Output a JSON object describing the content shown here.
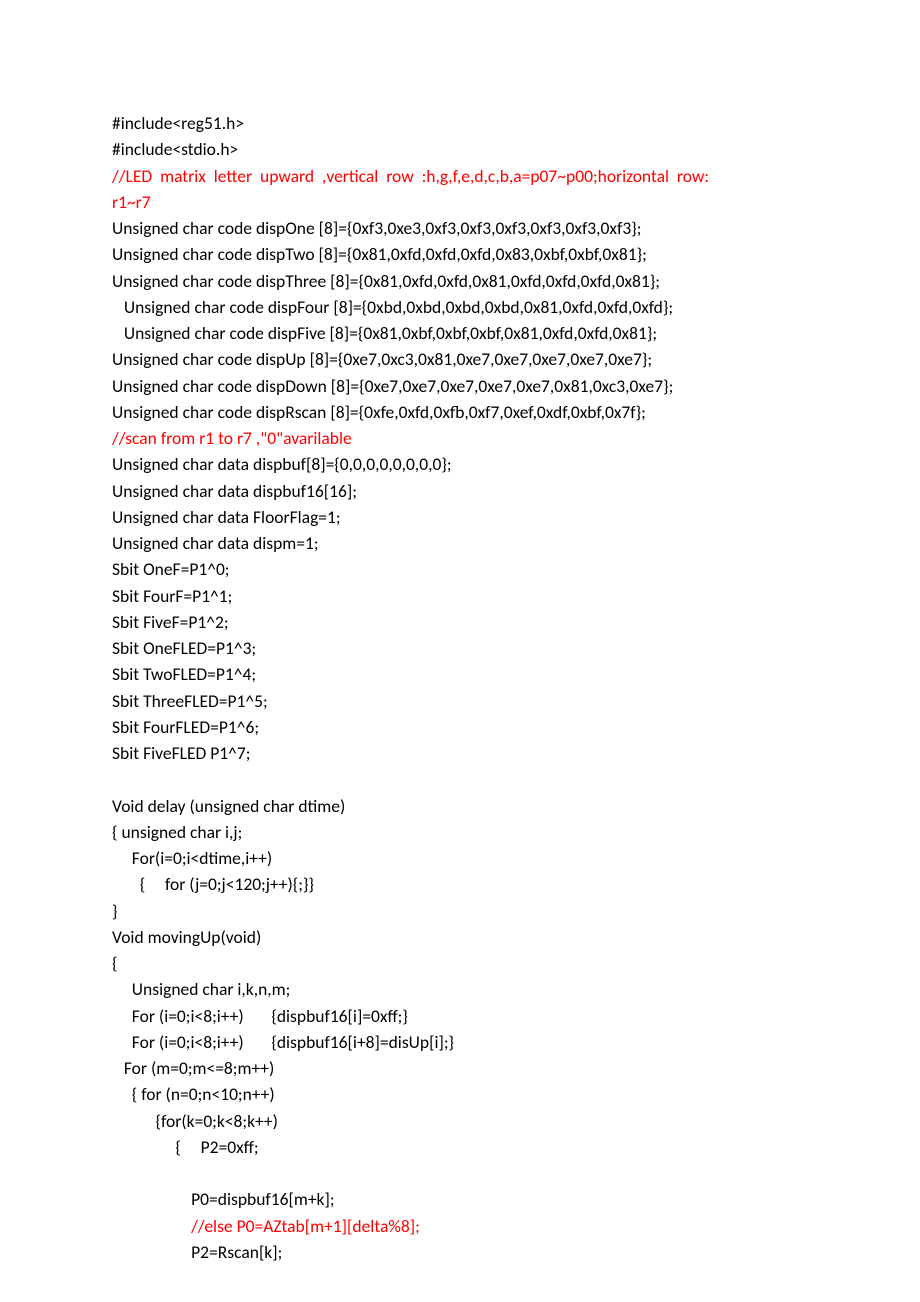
{
  "lines": [
    {
      "runs": [
        {
          "t": "#include<reg51.h>",
          "c": "black"
        }
      ]
    },
    {
      "runs": [
        {
          "t": "#include<stdio.h>",
          "c": "black"
        }
      ]
    },
    {
      "runs": [
        {
          "t": "//LED  matrix  letter  upward  ,vertical  row  :h,g,f,e,d,c,b,a=p07~p00;horizontal  row: ",
          "c": "red"
        }
      ]
    },
    {
      "runs": [
        {
          "t": "r1~r7",
          "c": "red"
        }
      ]
    },
    {
      "runs": [
        {
          "t": "Unsigned char code dispOne [8]={0xf3,0xe3,0xf3,0xf3,0xf3,0xf3,0xf3,0xf3};",
          "c": "black"
        }
      ]
    },
    {
      "runs": [
        {
          "t": "Unsigned char code dispTwo [8]={0x81,0xfd,0xfd,0xfd,0x83,0xbf,0xbf,0x81};",
          "c": "black"
        }
      ]
    },
    {
      "runs": [
        {
          "t": "Unsigned char code dispThree [8]={0x81,0xfd,0xfd,0x81,0xfd,0xfd,0xfd,0x81};",
          "c": "black"
        }
      ]
    },
    {
      "runs": [
        {
          "t": "   Unsigned char code dispFour [8]={0xbd,0xbd,0xbd,0xbd,0x81,0xfd,0xfd,0xfd};",
          "c": "black"
        }
      ]
    },
    {
      "runs": [
        {
          "t": "   Unsigned char code dispFive [8]={0x81,0xbf,0xbf,0xbf,0x81,0xfd,0xfd,0x81};",
          "c": "black"
        }
      ]
    },
    {
      "runs": [
        {
          "t": "Unsigned char code dispUp [8]={0xe7,0xc3,0x81,0xe7,0xe7,0xe7,0xe7,0xe7};",
          "c": "black"
        }
      ]
    },
    {
      "runs": [
        {
          "t": "Unsigned char code dispDown [8]={0xe7,0xe7,0xe7,0xe7,0xe7,0x81,0xc3,0xe7};",
          "c": "black"
        }
      ]
    },
    {
      "runs": [
        {
          "t": "Unsigned char code dispRscan [8]={0xfe,0xfd,0xfb,0xf7,0xef,0xdf,0xbf,0x7f};",
          "c": "black"
        }
      ]
    },
    {
      "runs": [
        {
          "t": "//scan from r1 to r7 ,\"0\"avarilable",
          "c": "red"
        }
      ]
    },
    {
      "runs": [
        {
          "t": "Unsigned char data dispbuf[8]={0,0,0,0,0,0,0,0};",
          "c": "black"
        }
      ]
    },
    {
      "runs": [
        {
          "t": "Unsigned char data dispbuf16[16];",
          "c": "black"
        }
      ]
    },
    {
      "runs": [
        {
          "t": "Unsigned char data FloorFlag=1;",
          "c": "black"
        }
      ]
    },
    {
      "runs": [
        {
          "t": "Unsigned char data dispm=1;",
          "c": "black"
        }
      ]
    },
    {
      "runs": [
        {
          "t": "Sbit OneF=P1^0;",
          "c": "black"
        }
      ]
    },
    {
      "runs": [
        {
          "t": "Sbit FourF=P1^1;",
          "c": "black"
        }
      ]
    },
    {
      "runs": [
        {
          "t": "Sbit FiveF=P1^2;",
          "c": "black"
        }
      ]
    },
    {
      "runs": [
        {
          "t": "Sbit OneFLED=P1^3;",
          "c": "black"
        }
      ]
    },
    {
      "runs": [
        {
          "t": "Sbit TwoFLED=P1^4;",
          "c": "black"
        }
      ]
    },
    {
      "runs": [
        {
          "t": "Sbit ThreeFLED=P1^5;",
          "c": "black"
        }
      ]
    },
    {
      "runs": [
        {
          "t": "Sbit FourFLED=P1^6;",
          "c": "black"
        }
      ]
    },
    {
      "runs": [
        {
          "t": "Sbit FiveFLED P1^7;",
          "c": "black"
        }
      ]
    },
    {
      "empty": true
    },
    {
      "runs": [
        {
          "t": "Void delay (unsigned char dtime)",
          "c": "black"
        }
      ]
    },
    {
      "runs": [
        {
          "t": "{ unsigned char i,j;",
          "c": "black"
        }
      ]
    },
    {
      "runs": [
        {
          "t": "     For(i=0;i<dtime,i++)",
          "c": "black"
        }
      ]
    },
    {
      "runs": [
        {
          "t": "       {     for (j=0;j<120;j++){;}}",
          "c": "black"
        }
      ]
    },
    {
      "runs": [
        {
          "t": "}",
          "c": "black"
        }
      ]
    },
    {
      "runs": [
        {
          "t": "Void movingUp(void)",
          "c": "black"
        }
      ]
    },
    {
      "runs": [
        {
          "t": "{",
          "c": "black"
        }
      ]
    },
    {
      "runs": [
        {
          "t": "     Unsigned char i,k,n,m;",
          "c": "black"
        }
      ]
    },
    {
      "runs": [
        {
          "t": "     For (i=0;i<8;i++)       {dispbuf16[i]=0xff;}",
          "c": "black"
        }
      ]
    },
    {
      "runs": [
        {
          "t": "     For (i=0;i<8;i++)       {dispbuf16[i+8]=disUp[i];}",
          "c": "black"
        }
      ]
    },
    {
      "runs": [
        {
          "t": "   For (m=0;m<=8;m++)",
          "c": "black"
        }
      ]
    },
    {
      "runs": [
        {
          "t": "     { for (n=0;n<10;n++)",
          "c": "black"
        }
      ]
    },
    {
      "runs": [
        {
          "t": "           {for(k=0;k<8;k++)",
          "c": "black"
        }
      ]
    },
    {
      "runs": [
        {
          "t": "                {     P2=0xff;",
          "c": "black"
        }
      ]
    },
    {
      "empty": true
    },
    {
      "runs": [
        {
          "t": "                    P0=dispbuf16[m+k];",
          "c": "black"
        }
      ]
    },
    {
      "runs": [
        {
          "t": "                    //else P0=AZtab[m+1][delta%8];",
          "c": "red"
        }
      ]
    },
    {
      "runs": [
        {
          "t": "                    P2=Rscan[k];",
          "c": "black"
        }
      ]
    }
  ]
}
